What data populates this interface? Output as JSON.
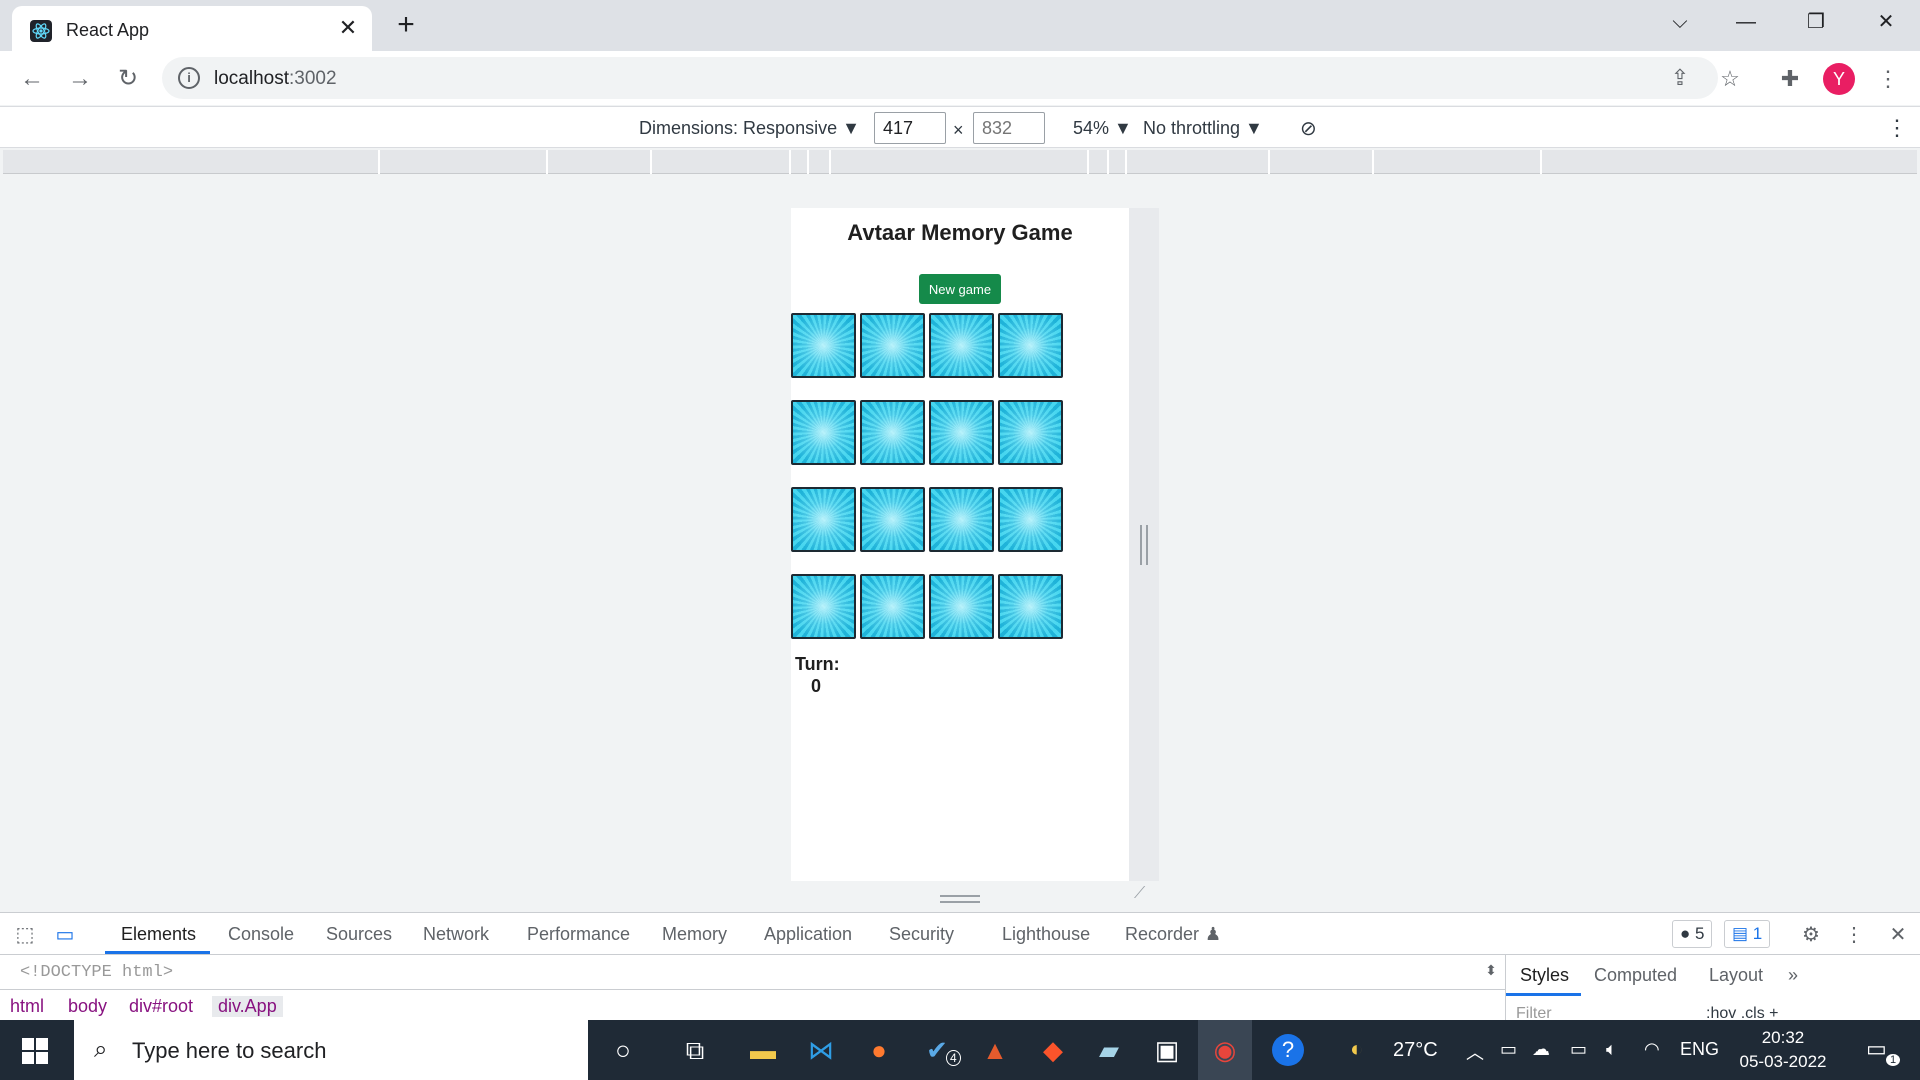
{
  "browser": {
    "tab_title": "React App",
    "tab_close": "✕",
    "new_tab": "+",
    "url_host": "localhost",
    "url_port": ":3002",
    "profile_initial": "Y"
  },
  "device_toolbar": {
    "dimensions_label": "Dimensions: Responsive ▼",
    "width_value": "417",
    "times": "×",
    "height_placeholder": "832",
    "zoom": "54% ▼",
    "throttling": "No throttling ▼"
  },
  "game": {
    "title": "Avtaar Memory Game",
    "new_game_label": "New game",
    "card_count": 16,
    "turn_label": "Turn:",
    "turn_value": "0",
    "card_color": "#1fb3d9"
  },
  "devtools": {
    "tabs": [
      "Elements",
      "Console",
      "Sources",
      "Network",
      "Performance",
      "Memory",
      "Application",
      "Security",
      "Lighthouse",
      "Recorder"
    ],
    "errors_count": "5",
    "messages_count": "1",
    "doctype": "<!DOCTYPE html>",
    "breadcrumbs": [
      "html",
      "body",
      "div#root",
      "div.App"
    ],
    "styles_tabs": [
      "Styles",
      "Computed",
      "Layout"
    ],
    "filter_placeholder": "Filter",
    "styles_more": "»",
    "hov_cls": ":hov  .cls  +"
  },
  "taskbar": {
    "search_placeholder": "Type here to search",
    "weather": "27°C",
    "language": "ENG",
    "time": "20:32",
    "date": "05-03-2022",
    "notification_count": "1",
    "vscode_badge": "4"
  }
}
